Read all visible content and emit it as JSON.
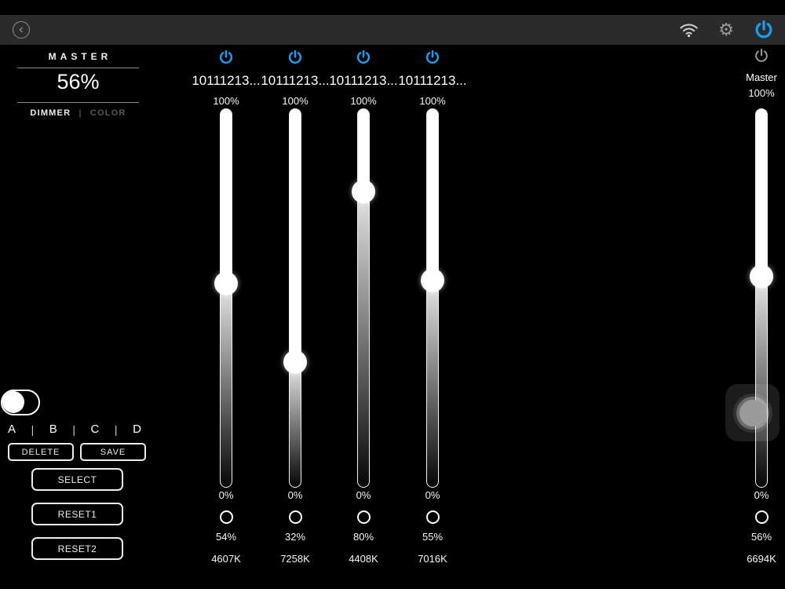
{
  "toolbar": {
    "back_icon": "chevron-left-circle",
    "wifi_icon": "wifi",
    "settings_icon": "gear",
    "power_icon": "power",
    "accent_blue": "#189df2",
    "bar_color": "#2b2b2b"
  },
  "master_panel": {
    "title": "MASTER",
    "value": "56%",
    "tab_dimmer": "DIMMER",
    "tab_separator": "|",
    "tab_color": "COLOR"
  },
  "channels": [
    {
      "name": "10111213...",
      "top_label": "100%",
      "bottom_label": "0%",
      "percent": "54%",
      "percent_value": 54,
      "kelvin": "4607K"
    },
    {
      "name": "10111213...",
      "top_label": "100%",
      "bottom_label": "0%",
      "percent": "32%",
      "percent_value": 32,
      "kelvin": "7258K"
    },
    {
      "name": "10111213...",
      "top_label": "100%",
      "bottom_label": "0%",
      "percent": "80%",
      "percent_value": 80,
      "kelvin": "4408K"
    },
    {
      "name": "10111213...",
      "top_label": "100%",
      "bottom_label": "0%",
      "percent": "55%",
      "percent_value": 55,
      "kelvin": "7016K"
    }
  ],
  "master_channel": {
    "name": "Master",
    "top_label": "100%",
    "bottom_label": "0%",
    "percent": "56%",
    "percent_value": 56,
    "kelvin": "6694K"
  },
  "scene_bar": {
    "letters": [
      "A",
      "B",
      "C",
      "D"
    ],
    "separator": "|"
  },
  "buttons": {
    "delete": "DELETE",
    "save": "SAVE",
    "select": "SELECT",
    "reset1": "RESET1",
    "reset2": "RESET2"
  }
}
